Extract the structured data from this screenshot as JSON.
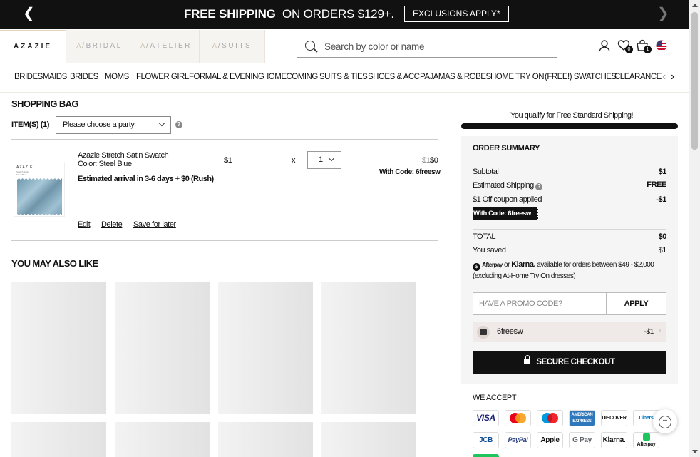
{
  "promo": {
    "main": "FREE SHIPPING",
    "sub": "ON ORDERS $129+.",
    "exclusions": "EXCLUSIONS APPLY*"
  },
  "header": {
    "brand_tabs": [
      "AZAZIE",
      "BRIDAL",
      "ATELIER",
      "SUITS"
    ],
    "search_placeholder": "Search by color or name",
    "wishlist_count": "0",
    "cart_count": "1"
  },
  "nav": {
    "items": [
      "BRIDESMAIDS",
      "BRIDES",
      "MOMS",
      "FLOWER GIRL",
      "FORMAL & EVENING",
      "HOMECOMING",
      "SUITS & TIES",
      "SHOES & ACC",
      "PAJAMAS & ROBES",
      "HOME TRY ON",
      "(FREE!) SWATCHES",
      "CLEARANCE"
    ]
  },
  "bag": {
    "title": "SHOPPING BAG",
    "items_label": "ITEM(S) (1)",
    "party_select": "Please choose a party",
    "item": {
      "thumb_logo": "AZAZIE",
      "thumb_caption": "Stretch Satin Steel Blue",
      "name": "Azazie Stretch Satin Swatch",
      "color": "Color:  Steel Blue",
      "eta": "Estimated arrival in 3-6 days + $0 (Rush)",
      "unit_price": "$1",
      "times": "x",
      "qty": "1",
      "old_price": "$1",
      "new_price": "$0",
      "with_code": "With Code: 6freesw",
      "actions": [
        "Edit",
        "Delete",
        "Save for later"
      ]
    }
  },
  "also_like": {
    "title": "YOU MAY ALSO LIKE"
  },
  "summary": {
    "qualify": "You qualify for Free Standard Shipping!",
    "shipping_progress": 1.0,
    "title": "ORDER SUMMARY",
    "subtotal_label": "Subtotal",
    "subtotal": "$1",
    "shipping_label": "Estimated Shipping",
    "shipping": "FREE",
    "coupon_label": "$1 Off coupon applied",
    "coupon_amt": "-$1",
    "code_chip": "With Code: 6freesw",
    "total_label": "TOTAL",
    "total": "$0",
    "saved_label": "You saved",
    "saved": "$1",
    "afterpay": "Afterpay",
    "or": "or",
    "klarna": "Klarna.",
    "bnpl_text": "available for orders between $49 - $2,000",
    "bnpl_note": "(excluding At-Home Try On dresses)",
    "promo_placeholder": "HAVE A PROMO CODE?",
    "apply": "APPLY",
    "coupon_code": "6freesw",
    "coupon_value": "-$1",
    "checkout": "SECURE CHECKOUT"
  },
  "accept": {
    "title": "WE ACCEPT",
    "methods": [
      "VISA",
      "Mastercard",
      "Maestro",
      "AMERICAN EXPRESS",
      "DISCOVER",
      "Diners",
      "JCB",
      "PayPal",
      "Apple Pay",
      "G Pay",
      "Klarna.",
      "Afterpay"
    ]
  },
  "colors": {
    "black": "#111111",
    "summary_bg": "#f5f5f5",
    "coupon_bg": "#efe9e7"
  }
}
